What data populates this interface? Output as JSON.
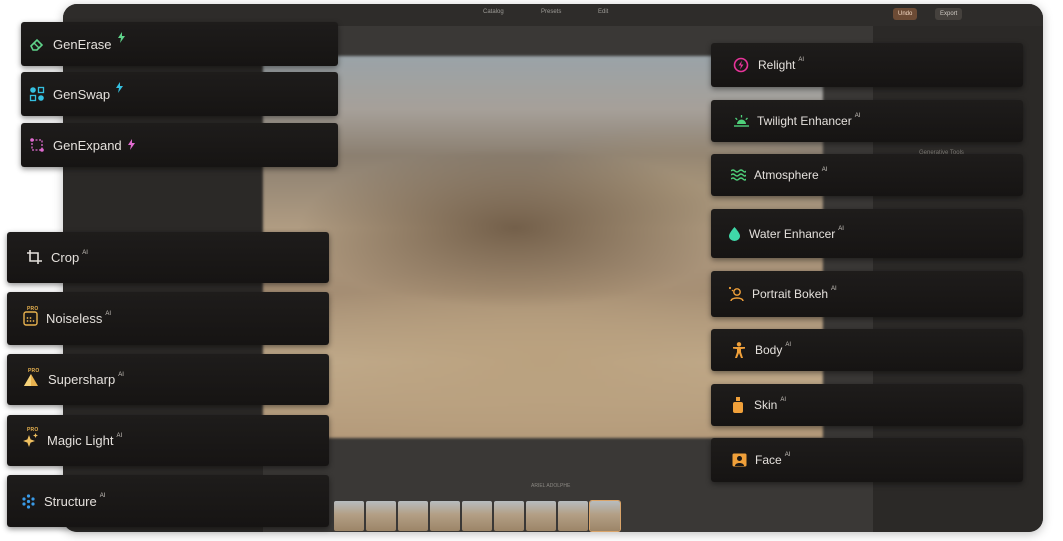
{
  "titlebar": {
    "tabs": [
      "Catalog",
      "Presets",
      "Edit"
    ],
    "buttons": [
      "Undo",
      "Export"
    ]
  },
  "right_panel": {
    "section_label": "Generative Tools"
  },
  "filmstrip": {
    "label": "ARIEL ADOLPHE",
    "thumb_count": 9
  },
  "gen_tools": [
    {
      "label": "GenErase",
      "icon": "eraser-icon",
      "accent": "#5fd38a"
    },
    {
      "label": "GenSwap",
      "icon": "swap-icon",
      "accent": "#35c0e0"
    },
    {
      "label": "GenExpand",
      "icon": "expand-icon",
      "accent": "#e06bd0"
    }
  ],
  "left_tools": [
    {
      "label": "Crop",
      "ai": "AI",
      "icon": "crop-icon",
      "pro": ""
    },
    {
      "label": "Noiseless",
      "ai": "AI",
      "icon": "noiseless-icon",
      "pro": "PRO"
    },
    {
      "label": "Supersharp",
      "ai": "AI",
      "icon": "supersharp-icon",
      "pro": "PRO"
    },
    {
      "label": "Magic Light",
      "ai": "AI",
      "icon": "magic-light-icon",
      "pro": "PRO"
    },
    {
      "label": "Structure",
      "ai": "AI",
      "icon": "structure-icon",
      "pro": ""
    }
  ],
  "right_tools": [
    {
      "label": "Relight",
      "ai": "AI",
      "icon": "relight-icon",
      "color": "#e8349a"
    },
    {
      "label": "Twilight Enhancer",
      "ai": "AI",
      "icon": "twilight-icon",
      "color": "#4fd07a"
    },
    {
      "label": "Atmosphere",
      "ai": "AI",
      "icon": "atmosphere-icon",
      "color": "#4fd07a"
    },
    {
      "label": "Water Enhancer",
      "ai": "AI",
      "icon": "water-drop-icon",
      "color": "#3fd9a8"
    },
    {
      "label": "Portrait Bokeh",
      "ai": "AI",
      "icon": "portrait-bokeh-icon",
      "color": "#f0a03a"
    },
    {
      "label": "Body",
      "ai": "AI",
      "icon": "body-icon",
      "color": "#f0a03a"
    },
    {
      "label": "Skin",
      "ai": "AI",
      "icon": "skin-icon",
      "color": "#f0a03a"
    },
    {
      "label": "Face",
      "ai": "AI",
      "icon": "face-icon",
      "color": "#f0a03a"
    }
  ]
}
